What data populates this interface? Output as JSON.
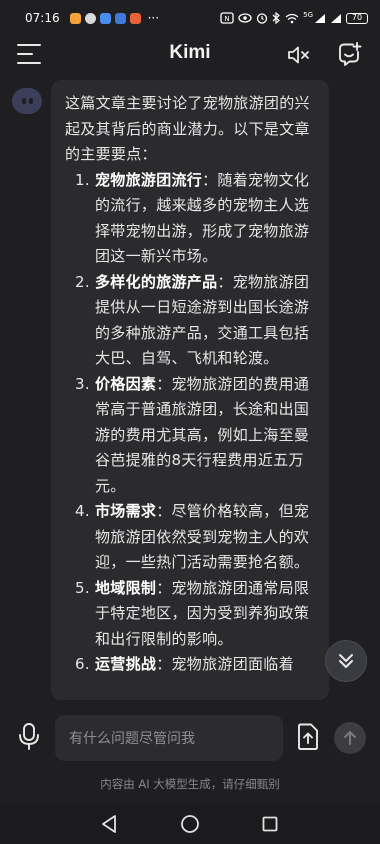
{
  "status_bar": {
    "time": "07:16",
    "more": "···",
    "network": "5G",
    "battery": "70"
  },
  "header": {
    "title": "Kimi"
  },
  "message": {
    "intro": "这篇文章主要讨论了宠物旅游团的兴起及其背后的商业潜力。以下是文章的主要要点：",
    "items": [
      {
        "num": "1.",
        "title": "宠物旅游团流行",
        "text": "：随着宠物文化的流行，越来越多的宠物主人选择带宠物出游，形成了宠物旅游团这一新兴市场。"
      },
      {
        "num": "2.",
        "title": "多样化的旅游产品",
        "text": "：宠物旅游团提供从一日短途游到出国长途游的多种旅游产品，交通工具包括大巴、自驾、飞机和轮渡。"
      },
      {
        "num": "3.",
        "title": "价格因素",
        "text": "：宠物旅游团的费用通常高于普通旅游团，长途和出国游的费用尤其高，例如上海至曼谷芭提雅的8天行程费用近五万元。"
      },
      {
        "num": "4.",
        "title": "市场需求",
        "text": "：尽管价格较高，但宠物旅游团依然受到宠物主人的欢迎，一些热门活动需要抢名额。"
      },
      {
        "num": "5.",
        "title": "地域限制",
        "text": "：宠物旅游团通常局限于特定地区，因为受到养狗政策和出行限制的影响。"
      },
      {
        "num": "6.",
        "title": "运营挑战",
        "text": "：宠物旅游团面临着"
      }
    ]
  },
  "input": {
    "placeholder": "有什么问题尽管问我"
  },
  "disclaimer": "内容由 AI 大模型生成，请仔细甄别"
}
